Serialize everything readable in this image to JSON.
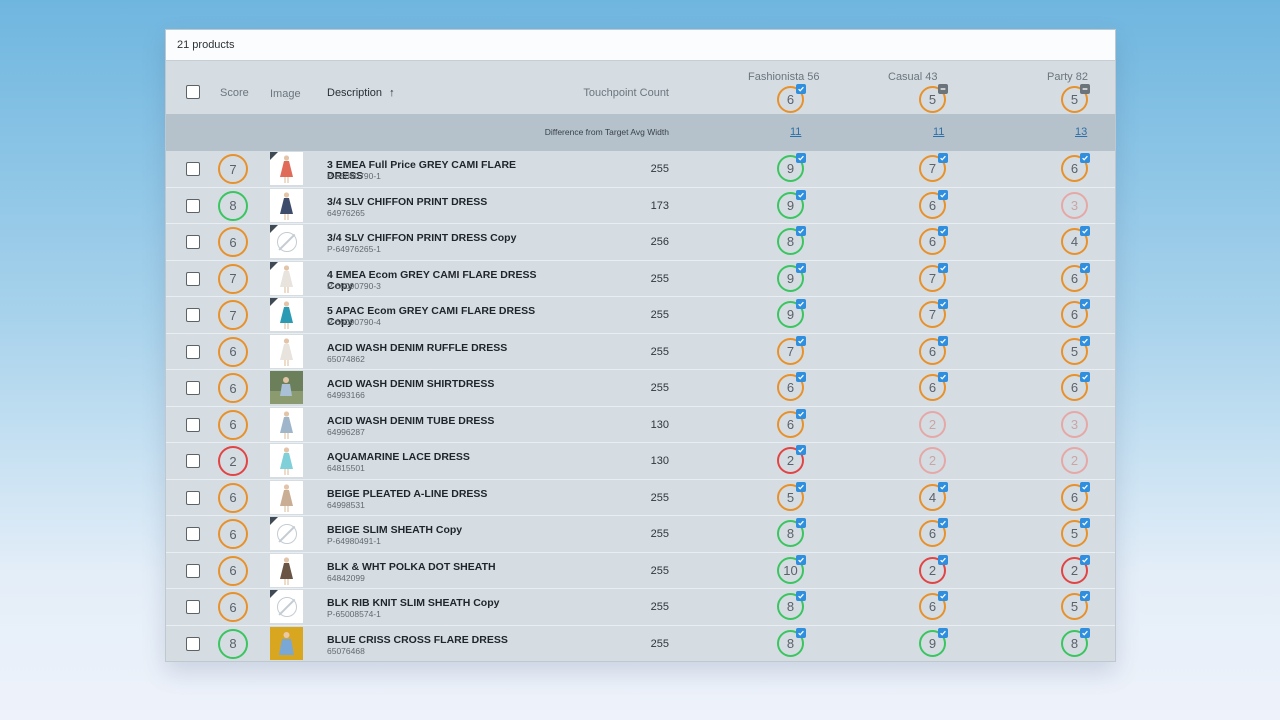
{
  "header": {
    "product_count": "21 products",
    "col_score": "Score",
    "col_image": "Image",
    "col_description": "Description",
    "col_touchpoint": "Touchpoint Count",
    "sort_arrow": "↑",
    "targets": [
      {
        "name": "Fashionista 56",
        "value": "6",
        "tick": "blue"
      },
      {
        "name": "Casual 43",
        "value": "5",
        "tick": "grey"
      },
      {
        "name": "Party 82",
        "value": "5",
        "tick": "grey"
      }
    ]
  },
  "diff_row": {
    "label": "Difference from Target Avg Width",
    "values": [
      "11",
      "11",
      "13"
    ]
  },
  "colors": {
    "orange": "#e8912a",
    "green": "#3bc560",
    "red": "#e24444",
    "faded": "#e5a8a6",
    "accent_blue": "#2f8fde"
  },
  "rows": [
    {
      "score": "7",
      "score_color": "orange",
      "thumb": "dress-red",
      "no_image": false,
      "corner": true,
      "name": "3 EMEA Full Price GREY CAMI FLARE DRESS",
      "sku": "P-65090790-1",
      "touchpoint": "255",
      "cols": [
        {
          "v": "9",
          "c": "green",
          "t": true
        },
        {
          "v": "7",
          "c": "orange",
          "t": true
        },
        {
          "v": "6",
          "c": "orange",
          "t": true
        }
      ]
    },
    {
      "score": "8",
      "score_color": "green",
      "thumb": "dress-navy",
      "no_image": false,
      "corner": false,
      "name": "3/4 SLV CHIFFON PRINT DRESS",
      "sku": "64976265",
      "touchpoint": "173",
      "cols": [
        {
          "v": "9",
          "c": "green",
          "t": true
        },
        {
          "v": "6",
          "c": "orange",
          "t": true
        },
        {
          "v": "3",
          "c": "faded",
          "t": false
        }
      ]
    },
    {
      "score": "6",
      "score_color": "orange",
      "thumb": "none",
      "no_image": true,
      "corner": true,
      "name": "3/4 SLV CHIFFON PRINT DRESS Copy",
      "sku": "P-64976265-1",
      "touchpoint": "256",
      "cols": [
        {
          "v": "8",
          "c": "green",
          "t": true
        },
        {
          "v": "6",
          "c": "orange",
          "t": true
        },
        {
          "v": "4",
          "c": "orange",
          "t": true
        }
      ]
    },
    {
      "score": "7",
      "score_color": "orange",
      "thumb": "dress-white",
      "no_image": false,
      "corner": true,
      "name": "4 EMEA Ecom GREY CAMI FLARE DRESS Copy",
      "sku": "P-65090790-3",
      "touchpoint": "255",
      "cols": [
        {
          "v": "9",
          "c": "green",
          "t": true
        },
        {
          "v": "7",
          "c": "orange",
          "t": true
        },
        {
          "v": "6",
          "c": "orange",
          "t": true
        }
      ]
    },
    {
      "score": "7",
      "score_color": "orange",
      "thumb": "dress-teal",
      "no_image": false,
      "corner": true,
      "name": "5 APAC Ecom GREY CAMI FLARE DRESS Copy",
      "sku": "P-65090790-4",
      "touchpoint": "255",
      "cols": [
        {
          "v": "9",
          "c": "green",
          "t": true
        },
        {
          "v": "7",
          "c": "orange",
          "t": true
        },
        {
          "v": "6",
          "c": "orange",
          "t": true
        }
      ]
    },
    {
      "score": "6",
      "score_color": "orange",
      "thumb": "dress-white",
      "no_image": false,
      "corner": false,
      "name": "ACID WASH DENIM RUFFLE DRESS",
      "sku": "65074862",
      "touchpoint": "255",
      "cols": [
        {
          "v": "7",
          "c": "orange",
          "t": true
        },
        {
          "v": "6",
          "c": "orange",
          "t": true
        },
        {
          "v": "5",
          "c": "orange",
          "t": true
        }
      ]
    },
    {
      "score": "6",
      "score_color": "orange",
      "thumb": "photo-outdoor",
      "no_image": false,
      "corner": false,
      "name": "ACID WASH DENIM SHIRTDRESS",
      "sku": "64993166",
      "touchpoint": "255",
      "cols": [
        {
          "v": "6",
          "c": "orange",
          "t": true
        },
        {
          "v": "6",
          "c": "orange",
          "t": true
        },
        {
          "v": "6",
          "c": "orange",
          "t": true
        }
      ]
    },
    {
      "score": "6",
      "score_color": "orange",
      "thumb": "dress-denim",
      "no_image": false,
      "corner": false,
      "name": "ACID WASH DENIM TUBE DRESS",
      "sku": "64996287",
      "touchpoint": "130",
      "cols": [
        {
          "v": "6",
          "c": "orange",
          "t": true
        },
        {
          "v": "2",
          "c": "faded",
          "t": false
        },
        {
          "v": "3",
          "c": "faded",
          "t": false
        }
      ]
    },
    {
      "score": "2",
      "score_color": "red",
      "thumb": "dress-aqua",
      "no_image": false,
      "corner": false,
      "name": "AQUAMARINE LACE DRESS",
      "sku": "64815501",
      "touchpoint": "130",
      "cols": [
        {
          "v": "2",
          "c": "red",
          "t": true
        },
        {
          "v": "2",
          "c": "faded",
          "t": false
        },
        {
          "v": "2",
          "c": "faded",
          "t": false
        }
      ]
    },
    {
      "score": "6",
      "score_color": "orange",
      "thumb": "dress-beige",
      "no_image": false,
      "corner": false,
      "name": "BEIGE PLEATED A-LINE DRESS",
      "sku": "64998531",
      "touchpoint": "255",
      "cols": [
        {
          "v": "5",
          "c": "orange",
          "t": true
        },
        {
          "v": "4",
          "c": "orange",
          "t": true
        },
        {
          "v": "6",
          "c": "orange",
          "t": true
        }
      ]
    },
    {
      "score": "6",
      "score_color": "orange",
      "thumb": "none",
      "no_image": true,
      "corner": true,
      "name": "BEIGE SLIM SHEATH Copy",
      "sku": "P-64980491-1",
      "touchpoint": "255",
      "cols": [
        {
          "v": "8",
          "c": "green",
          "t": true
        },
        {
          "v": "6",
          "c": "orange",
          "t": true
        },
        {
          "v": "5",
          "c": "orange",
          "t": true
        }
      ]
    },
    {
      "score": "6",
      "score_color": "orange",
      "thumb": "dress-brown",
      "no_image": false,
      "corner": false,
      "name": "BLK & WHT POLKA DOT SHEATH",
      "sku": "64842099",
      "touchpoint": "255",
      "cols": [
        {
          "v": "10",
          "c": "green",
          "t": true
        },
        {
          "v": "2",
          "c": "red",
          "t": true
        },
        {
          "v": "2",
          "c": "red",
          "t": true
        }
      ]
    },
    {
      "score": "6",
      "score_color": "orange",
      "thumb": "none",
      "no_image": true,
      "corner": true,
      "name": "BLK RIB KNIT SLIM SHEATH Copy",
      "sku": "P-65008574-1",
      "touchpoint": "255",
      "cols": [
        {
          "v": "8",
          "c": "green",
          "t": true
        },
        {
          "v": "6",
          "c": "orange",
          "t": true
        },
        {
          "v": "5",
          "c": "orange",
          "t": true
        }
      ]
    },
    {
      "score": "8",
      "score_color": "green",
      "thumb": "photo-gold",
      "no_image": false,
      "corner": false,
      "name": "BLUE CRISS CROSS FLARE DRESS",
      "sku": "65076468",
      "touchpoint": "255",
      "cols": [
        {
          "v": "8",
          "c": "green",
          "t": true
        },
        {
          "v": "9",
          "c": "green",
          "t": true
        },
        {
          "v": "8",
          "c": "green",
          "t": true
        }
      ]
    }
  ]
}
